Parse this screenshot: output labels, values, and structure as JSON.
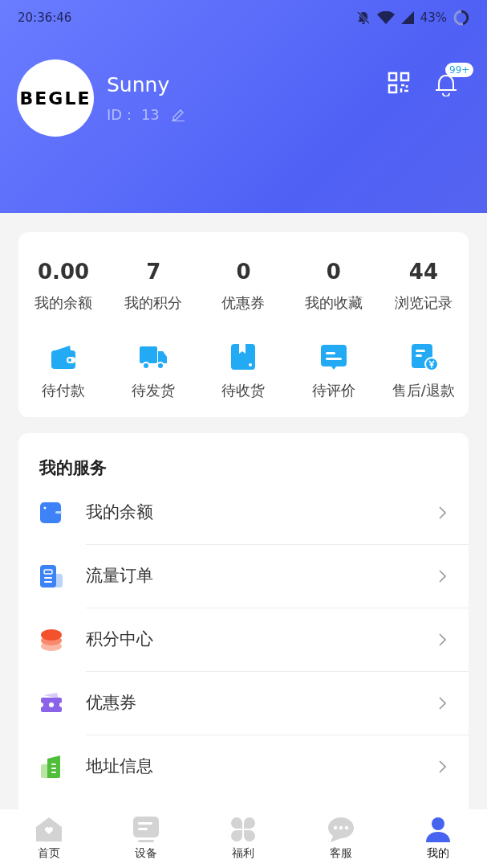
{
  "status_bar": {
    "time": "20:36:46",
    "battery": "43%"
  },
  "profile": {
    "logo": "BEGLE",
    "name": "Sunny",
    "id_label": "ID：",
    "id": "13",
    "badge": "99+"
  },
  "stats": [
    {
      "value": "0.00",
      "label": "我的余额"
    },
    {
      "value": "7",
      "label": "我的积分"
    },
    {
      "value": "0",
      "label": "优惠券"
    },
    {
      "value": "0",
      "label": "我的收藏"
    },
    {
      "value": "44",
      "label": "浏览记录"
    }
  ],
  "orders": [
    {
      "kind": "wallet",
      "label": "待付款"
    },
    {
      "kind": "truck",
      "label": "待发货"
    },
    {
      "kind": "box",
      "label": "待收货"
    },
    {
      "kind": "comment",
      "label": "待评价"
    },
    {
      "kind": "refund",
      "label": "售后/退款"
    }
  ],
  "services": {
    "title": "我的服务",
    "items": [
      {
        "kind": "balance",
        "label": "我的余额"
      },
      {
        "kind": "orders",
        "label": "流量订单"
      },
      {
        "kind": "points",
        "label": "积分中心"
      },
      {
        "kind": "coupon",
        "label": "优惠券"
      },
      {
        "kind": "address",
        "label": "地址信息"
      }
    ]
  },
  "tab_bar": [
    {
      "kind": "home",
      "label": "首页",
      "selected": false
    },
    {
      "kind": "device",
      "label": "设备",
      "selected": false
    },
    {
      "kind": "welfare",
      "label": "福利",
      "selected": false
    },
    {
      "kind": "service",
      "label": "客服",
      "selected": false
    },
    {
      "kind": "me",
      "label": "我的",
      "selected": true
    }
  ]
}
